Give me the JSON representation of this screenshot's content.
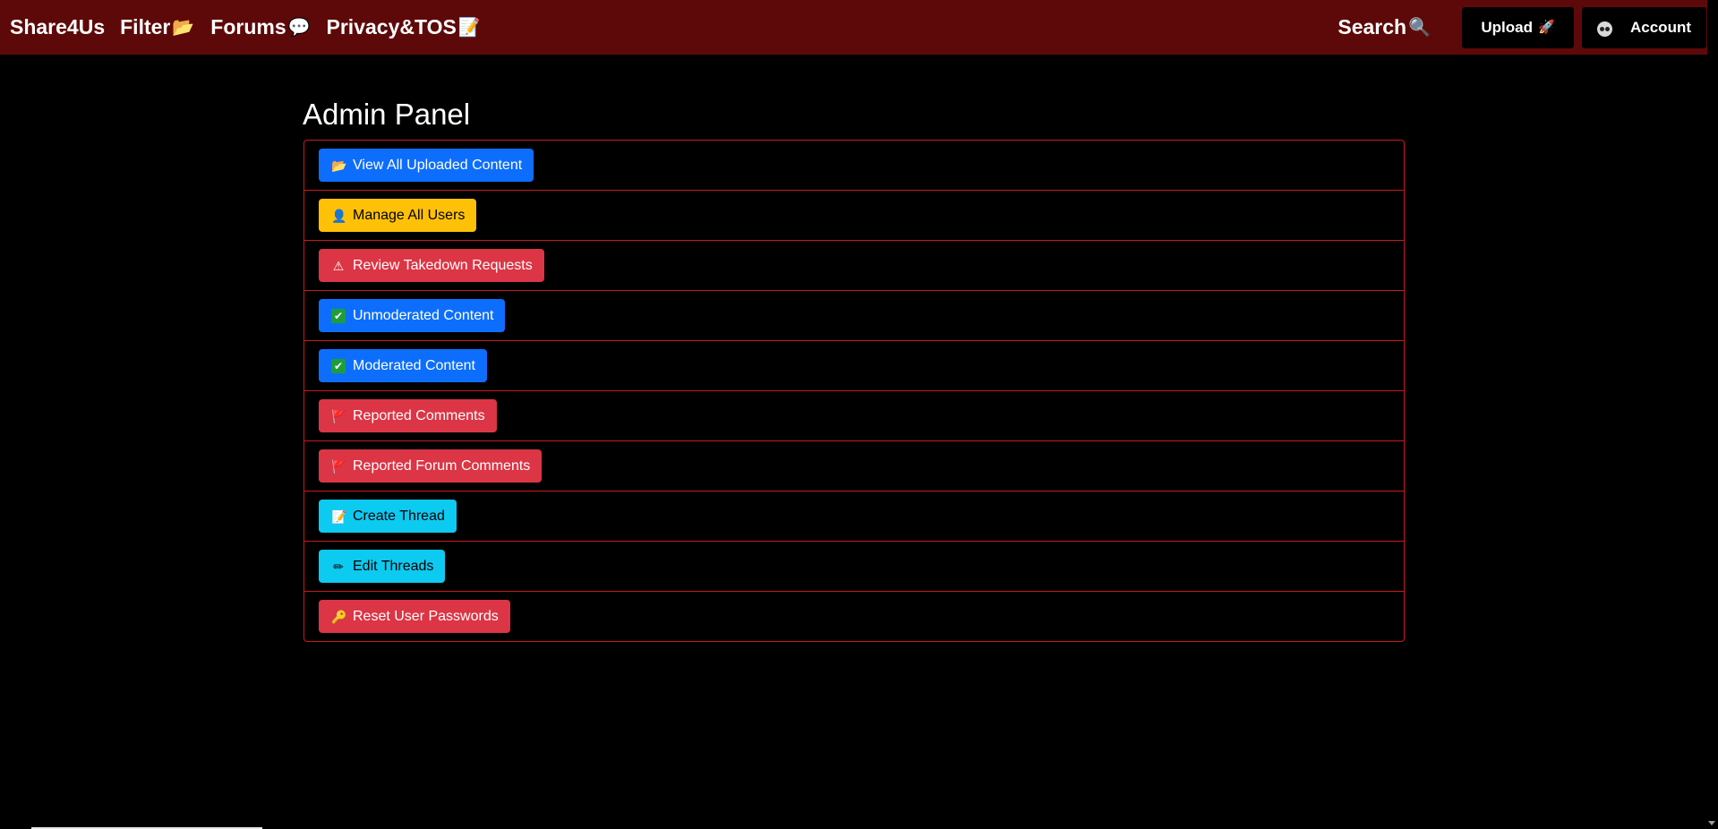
{
  "navbar": {
    "brand": "Share4Us",
    "links": [
      {
        "label": "Filter",
        "emoji": "📂",
        "icon": "folder-icon"
      },
      {
        "label": "Forums",
        "emoji": "💬",
        "icon": "speech-bubble-icon"
      },
      {
        "label": "Privacy&TOS",
        "emoji": "📝",
        "icon": "memo-icon"
      }
    ],
    "search_label": "Search",
    "search_emoji": "🔍",
    "upload_label": "Upload",
    "upload_emoji": "🚀",
    "account_label": "Account",
    "background_color": "#5e0909"
  },
  "page": {
    "title": "Admin Panel",
    "border_color": "#c81a1a"
  },
  "admin_actions": [
    {
      "label": "View All Uploaded Content",
      "emoji": "📂",
      "icon": "folder-icon",
      "color": "#0d6efd"
    },
    {
      "label": "Manage All Users",
      "emoji": "👤",
      "icon": "user-icon",
      "color": "#ffc107"
    },
    {
      "label": "Review Takedown Requests",
      "emoji": "⚠",
      "icon": "warning-icon",
      "color": "#dc3545"
    },
    {
      "label": "Unmoderated Content",
      "emoji": "✔",
      "icon": "check-icon",
      "color": "#0d6efd"
    },
    {
      "label": "Moderated Content",
      "emoji": "✔",
      "icon": "check-icon",
      "color": "#0d6efd"
    },
    {
      "label": "Reported Comments",
      "emoji": "🚩",
      "icon": "flag-icon",
      "color": "#dc3545"
    },
    {
      "label": "Reported Forum Comments",
      "emoji": "🚩",
      "icon": "flag-icon",
      "color": "#dc3545"
    },
    {
      "label": "Create Thread",
      "emoji": "📝",
      "icon": "memo-icon",
      "color": "#0dcaf0"
    },
    {
      "label": "Edit Threads",
      "emoji": "✏",
      "icon": "pencil-icon",
      "color": "#0dcaf0"
    },
    {
      "label": "Reset User Passwords",
      "emoji": "🔑",
      "icon": "key-icon",
      "color": "#dc3545"
    }
  ]
}
